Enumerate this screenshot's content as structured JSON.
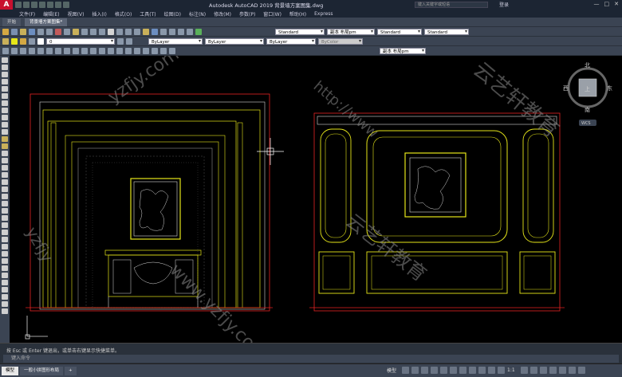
{
  "app": {
    "title": "Autodesk AutoCAD 2019    背景墙方案图集.dwg",
    "search_placeholder": "键入关键字或短语",
    "login_label": "登录",
    "window_controls": [
      "—",
      "□",
      "✕"
    ]
  },
  "menu": [
    "文件(F)",
    "编辑(E)",
    "视图(V)",
    "插入(I)",
    "格式(O)",
    "工具(T)",
    "绘图(D)",
    "标注(N)",
    "修改(M)",
    "参数(P)",
    "窗口(W)",
    "帮助(H)",
    "Express"
  ],
  "tabs": [
    {
      "label": "开始",
      "active": false
    },
    {
      "label": "背景墙方案图集*",
      "active": true
    }
  ],
  "toolbar": {
    "layer_value": "0",
    "color_value": "ByLayer",
    "linetype_value": "ByLayer",
    "lineweight_value": "ByLayer",
    "plotstyle_value": "ByColor",
    "text_style": "Standard",
    "dim_style": "副本 布局pm",
    "table_style": "Standard",
    "multileader_style": "Standard",
    "dim_style_2": "副本 布局pm"
  },
  "viewcube": {
    "north": "北",
    "south": "南",
    "east": "东",
    "west": "西",
    "top": "上",
    "wcs": "WCS"
  },
  "watermarks": [
    "yzfjy.com",
    "http://www",
    "云艺轩教育",
    "www.yzfjy.com",
    "yzfjy"
  ],
  "command": {
    "history": "按 Esc 或 Enter 键退出，或单击右键显示快捷菜单。",
    "prompt": "键入命令"
  },
  "status": {
    "layout_tabs": [
      {
        "label": "模型",
        "active": true
      },
      {
        "label": "一般小拼图形布局",
        "active": false
      },
      {
        "label": "+",
        "active": false
      }
    ],
    "model_label": "模型",
    "scale": "1:1"
  },
  "colors": {
    "cad_yellow": "#e6e619",
    "cad_red": "#e52222",
    "cad_white": "#d8d8d8",
    "cad_background": "#000000",
    "ui_dark": "#3b4453"
  }
}
